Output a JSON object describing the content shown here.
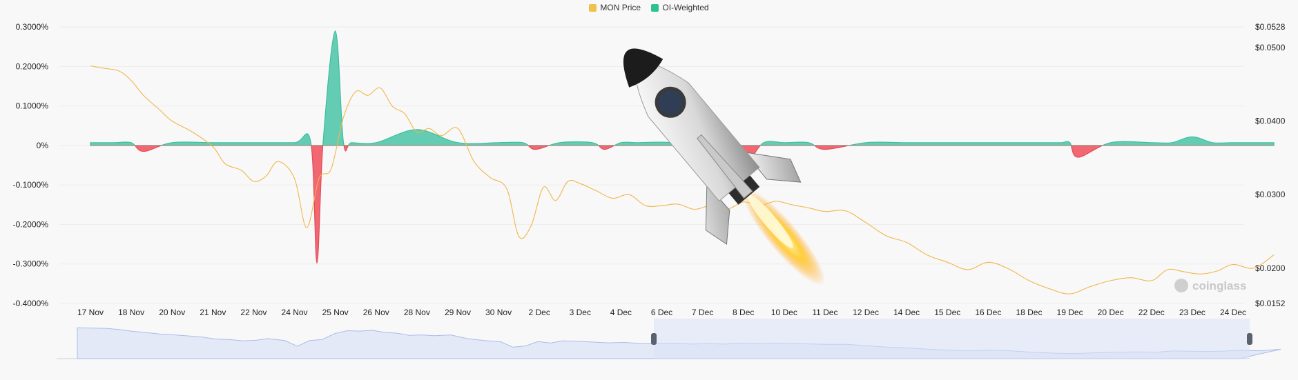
{
  "legend": {
    "price_label": "MON Price",
    "oi_label": "OI-Weighted"
  },
  "watermark": {
    "text": "coinglass"
  },
  "colors": {
    "price": "#f0b64c",
    "positive": "#3dbf9c",
    "positive_fill": "#5cc9ae",
    "negative": "#f0606a",
    "grid": "#ececec",
    "navigator": "#a9bde6",
    "navigator_fill": "#e3e9f6",
    "navigator_selected": "#d8e2f8"
  },
  "chart_data": {
    "type": "area",
    "left_axis": {
      "ticks": [
        "0.3000%",
        "0.2000%",
        "0.1000%",
        "0%",
        "-0.1000%",
        "-0.2000%",
        "-0.3000%",
        "-0.4000%"
      ],
      "tick_values": [
        0.3,
        0.2,
        0.1,
        0,
        -0.1,
        -0.2,
        -0.3,
        -0.4
      ],
      "ylim": [
        -0.4,
        0.3
      ]
    },
    "right_axis": {
      "ticks": [
        "$0.0528",
        "$0.0500",
        "$0.0400",
        "$0.0300",
        "$0.0200",
        "$0.0152"
      ],
      "tick_values": [
        0.0528,
        0.05,
        0.04,
        0.03,
        0.02,
        0.0152
      ],
      "ylim": [
        0.0152,
        0.0528
      ]
    },
    "categories": [
      "17 Nov",
      "18 Nov",
      "20 Nov",
      "21 Nov",
      "22 Nov",
      "24 Nov",
      "25 Nov",
      "26 Nov",
      "28 Nov",
      "29 Nov",
      "30 Nov",
      "2 Dec",
      "3 Dec",
      "4 Dec",
      "6 Dec",
      "7 Dec",
      "8 Dec",
      "10 Dec",
      "11 Dec",
      "12 Dec",
      "14 Dec",
      "15 Dec",
      "16 Dec",
      "18 Dec",
      "19 Dec",
      "20 Dec",
      "22 Dec",
      "23 Dec",
      "24 Dec"
    ],
    "series": [
      {
        "name": "OI-Weighted",
        "axis": "left",
        "x": [
          0,
          0.6,
          1,
          1.3,
          2,
          3,
          4,
          5,
          5.4,
          5.55,
          5.7,
          6,
          6.2,
          6.4,
          7,
          8,
          9,
          10,
          10.6,
          10.9,
          11.5,
          12.3,
          12.6,
          13,
          13.4,
          14.2,
          14.5,
          15,
          15.8,
          16.1,
          16.5,
          17,
          17.6,
          18,
          19,
          19.9,
          20.2,
          20.4,
          20.8,
          21,
          21.3,
          21.6,
          22,
          22.5,
          23,
          23.5,
          23.6,
          23.8,
          24,
          24.2,
          25,
          26,
          26.5,
          27,
          27.5,
          28,
          29
        ],
        "values": [
          0.007,
          0.007,
          0.007,
          -0.015,
          0.007,
          0.007,
          0.007,
          0.007,
          0.007,
          -0.298,
          0.007,
          0.29,
          0.007,
          0.007,
          0.007,
          0.04,
          0.007,
          0.007,
          0.007,
          -0.01,
          0.007,
          0.007,
          -0.01,
          0.007,
          0.007,
          0.007,
          -0.012,
          0.007,
          0.007,
          -0.038,
          0.007,
          0.007,
          0.007,
          -0.01,
          0.007,
          0.007,
          0.007,
          0.007,
          0.007,
          0.007,
          0.007,
          0.007,
          0.007,
          0.007,
          0.007,
          0.007,
          0.007,
          0.007,
          0.007,
          -0.03,
          0.007,
          0.007,
          0.007,
          0.022,
          0.007,
          0.007,
          0.007
        ]
      },
      {
        "name": "MON Price",
        "axis": "right",
        "x": [
          0,
          0.3,
          0.7,
          1,
          1.3,
          1.7,
          2,
          2.5,
          3,
          3.3,
          3.7,
          4,
          4.3,
          4.6,
          5,
          5.3,
          5.6,
          5.9,
          6.2,
          6.5,
          6.8,
          7.1,
          7.4,
          7.7,
          8,
          8.3,
          8.6,
          9,
          9.4,
          9.8,
          10.2,
          10.5,
          10.8,
          11.1,
          11.4,
          11.7,
          12,
          12.4,
          12.8,
          13.2,
          13.6,
          14,
          14.4,
          14.8,
          15.2,
          15.6,
          16,
          16.4,
          16.8,
          17.2,
          17.6,
          18,
          18.5,
          19,
          19.5,
          20,
          20.5,
          21,
          21.5,
          22,
          22.5,
          23,
          23.5,
          24,
          24.5,
          25,
          25.5,
          26,
          26.4,
          26.8,
          27.2,
          27.6,
          28,
          28.5,
          29
        ],
        "values": [
          0.0475,
          0.0472,
          0.0468,
          0.0455,
          0.0435,
          0.0415,
          0.04,
          0.0385,
          0.0365,
          0.0342,
          0.0333,
          0.0318,
          0.0325,
          0.0345,
          0.0322,
          0.0255,
          0.0322,
          0.0335,
          0.0405,
          0.044,
          0.0435,
          0.0445,
          0.042,
          0.041,
          0.0385,
          0.039,
          0.038,
          0.039,
          0.0345,
          0.0323,
          0.0308,
          0.0243,
          0.0258,
          0.031,
          0.0292,
          0.0318,
          0.0315,
          0.0305,
          0.0295,
          0.03,
          0.0285,
          0.0285,
          0.0287,
          0.028,
          0.0285,
          0.028,
          0.029,
          0.0285,
          0.0291,
          0.0286,
          0.0282,
          0.0277,
          0.0278,
          0.0262,
          0.0244,
          0.0235,
          0.0218,
          0.0208,
          0.0198,
          0.0208,
          0.0199,
          0.0183,
          0.0172,
          0.0165,
          0.0175,
          0.0183,
          0.0187,
          0.0183,
          0.0198,
          0.0195,
          0.0192,
          0.0196,
          0.0205,
          0.02,
          0.0218
        ]
      }
    ],
    "grid": true,
    "legend_position": "top-center"
  }
}
